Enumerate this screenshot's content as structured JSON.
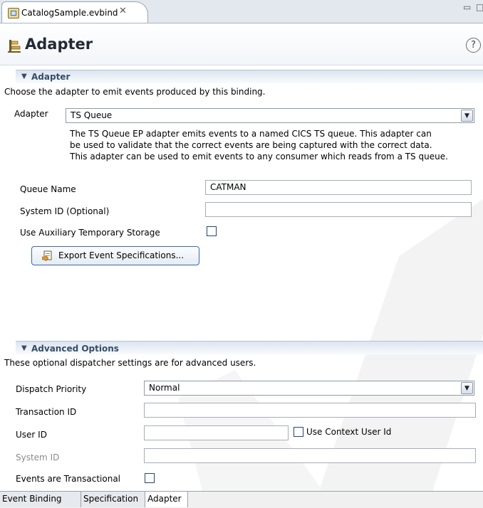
{
  "editor_tab": {
    "title": "CatalogSample.evbind",
    "close_glyph": "✕"
  },
  "window_controls": {
    "minimize_glyph": "▭",
    "maximize_glyph": "□"
  },
  "header": {
    "title": "Adapter",
    "help_glyph": "?"
  },
  "adapter_section": {
    "title": "Adapter",
    "description": "Choose the adapter to emit events produced by this binding.",
    "adapter_label": "Adapter",
    "adapter_value": "TS Queue",
    "adapter_help_lines": [
      "The TS Queue EP adapter emits events to a named CICS TS queue.  This adapter can",
      "be used to validate that the correct events are being captured with the correct data.",
      "This adapter can be used to emit events to any consumer which reads from a TS queue."
    ],
    "queue_name_label": "Queue Name",
    "queue_name_value": "CATMAN",
    "system_id_label": "System ID (Optional)",
    "system_id_value": "",
    "aux_storage_label": "Use Auxiliary Temporary Storage",
    "aux_storage_checked": false,
    "export_button_label": "Export Event Specifications..."
  },
  "advanced_section": {
    "title": "Advanced Options",
    "description": "These optional dispatcher settings are for advanced users.",
    "dispatch_priority_label": "Dispatch Priority",
    "dispatch_priority_value": "Normal",
    "transaction_id_label": "Transaction ID",
    "transaction_id_value": "",
    "user_id_label": "User ID",
    "user_id_value": "",
    "use_context_user_label": "Use Context User Id",
    "use_context_user_checked": false,
    "system_id_label": "System ID",
    "system_id_value": "",
    "events_transactional_label": "Events are Transactional",
    "events_transactional_checked": false
  },
  "bottom_tabs": [
    {
      "label": "Event Binding",
      "active": false
    },
    {
      "label": "Specification",
      "active": false
    },
    {
      "label": "Adapter",
      "active": true
    }
  ],
  "colors": {
    "section_title": "#364c68",
    "tab_bar": "#e3e8ef",
    "watermark": "#f1f1f1"
  },
  "icons": {
    "tab": "evbind-file-icon",
    "header": "adapter-icon",
    "help": "help-icon",
    "combo": "chevron-down-icon",
    "export": "export-icon"
  }
}
